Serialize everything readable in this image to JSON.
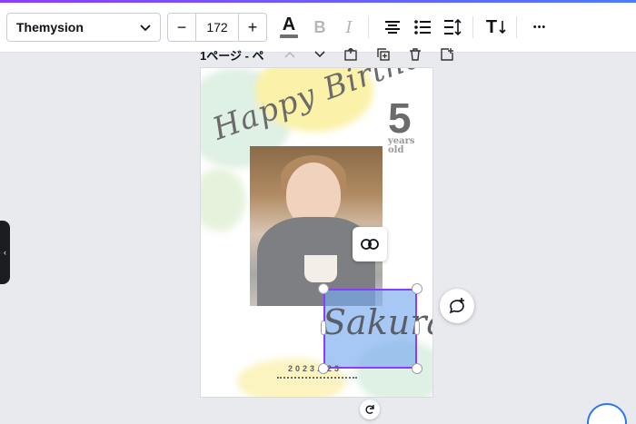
{
  "toolbar": {
    "font_name": "Themysion",
    "font_size": "172",
    "decrease_label": "−",
    "increase_label": "+",
    "text_color_glyph": "A",
    "bold_glyph": "B",
    "italic_glyph": "I",
    "text_size_glyph": "T",
    "more_glyph": "•••"
  },
  "pagebar": {
    "label": "1ページ - ペ"
  },
  "card": {
    "heading_script": "Happy Birthday",
    "age_number": "5",
    "years_line1": "years",
    "years_line2": "old",
    "name_script": "Sakura",
    "date": "2023.   23"
  },
  "colors": {
    "accent": "#8b3dff",
    "selection_fill": "#78aaf0"
  },
  "icons": {
    "chevron": "chevron-down-icon",
    "link": "link-icon",
    "comment": "comment-add-icon",
    "rotate": "rotate-icon"
  }
}
